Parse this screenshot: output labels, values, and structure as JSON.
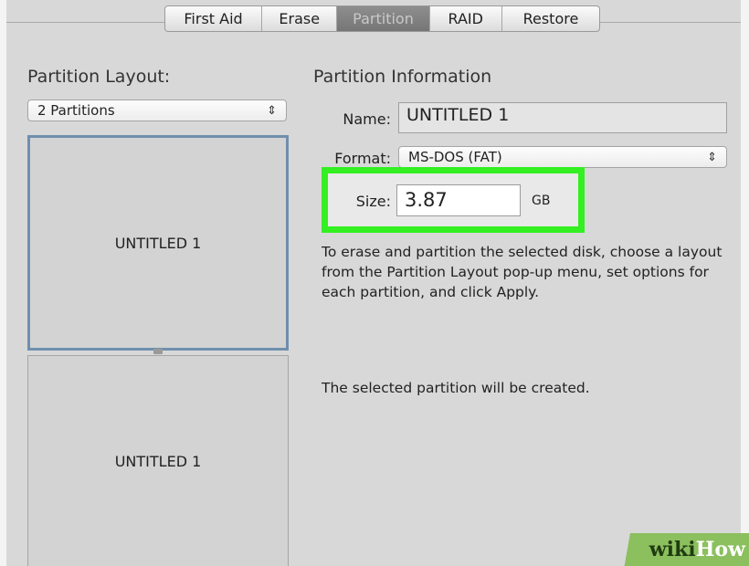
{
  "tabs": [
    {
      "label": "First Aid",
      "active": false
    },
    {
      "label": "Erase",
      "active": false
    },
    {
      "label": "Partition",
      "active": true
    },
    {
      "label": "RAID",
      "active": false
    },
    {
      "label": "Restore",
      "active": false
    }
  ],
  "layout": {
    "title": "Partition Layout:",
    "popup_value": "2 Partitions",
    "partitions": [
      "UNTITLED 1",
      "UNTITLED 1"
    ]
  },
  "info": {
    "title": "Partition Information",
    "name_label": "Name:",
    "name_value": "UNTITLED 1",
    "format_label": "Format:",
    "format_value": "MS-DOS (FAT)",
    "size_label": "Size:",
    "size_value": "3.87",
    "size_unit": "GB",
    "description": "To erase and partition the selected disk, choose a layout from the Partition Layout pop-up menu, set options for each partition, and click Apply.",
    "status": "The selected partition will be created."
  },
  "watermark": {
    "part1": "wiki",
    "part2": "How"
  },
  "colors": {
    "highlight": "#34ef22",
    "selected_border": "#6f8fae",
    "watermark_bg": "#8cbf5e"
  }
}
